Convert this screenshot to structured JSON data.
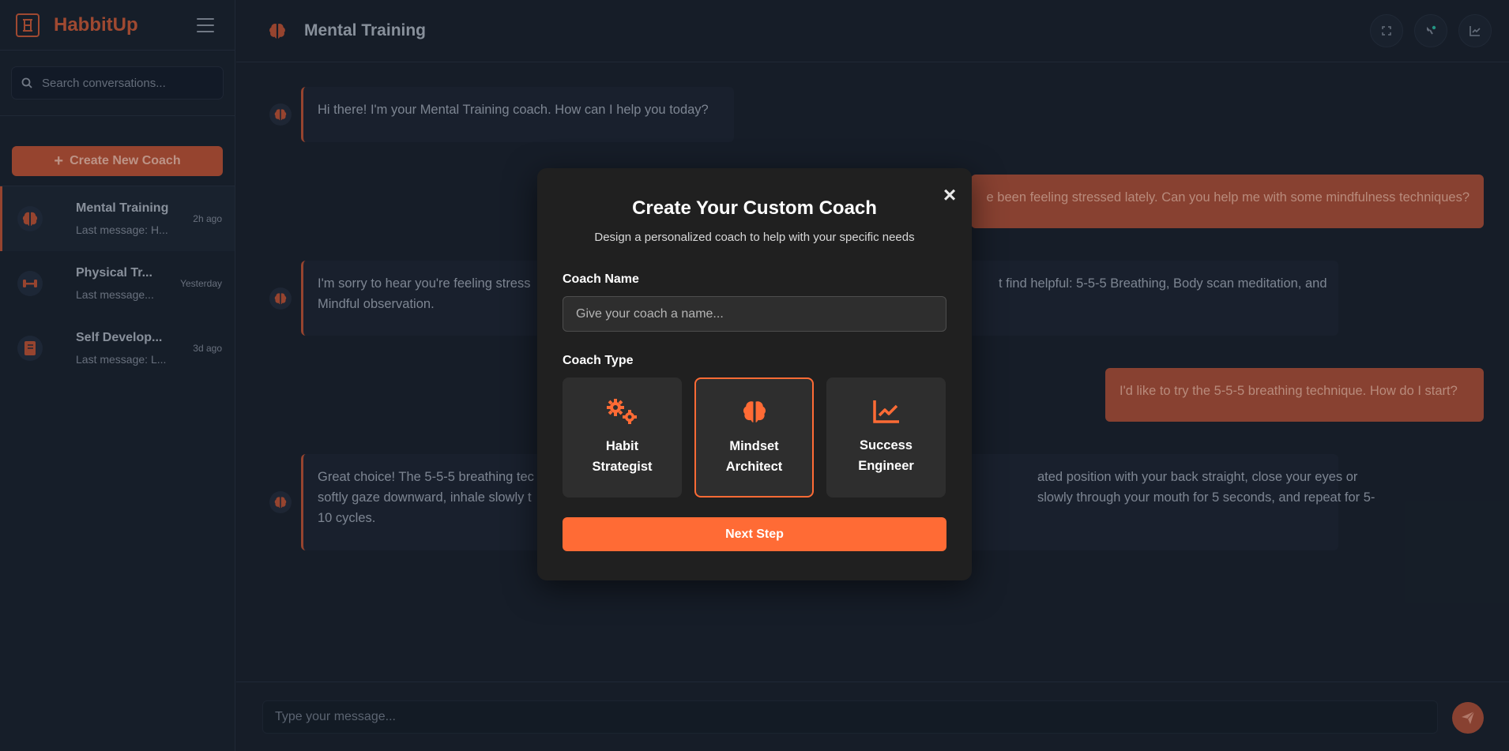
{
  "app": {
    "name": "HabbitUp",
    "accent": "#ff6b35"
  },
  "sidebar": {
    "search_placeholder": "Search conversations...",
    "create_label": "Create New Coach",
    "conversations": [
      {
        "title": "Mental Training",
        "last": "Last message: H...",
        "time": "2h ago",
        "icon": "brain-icon",
        "active": true
      },
      {
        "title": "Physical Tr...",
        "last": "Last message...",
        "time": "Yesterday",
        "icon": "dumbbell-icon",
        "active": false
      },
      {
        "title": "Self Develop...",
        "last": "Last message: L...",
        "time": "3d ago",
        "icon": "book-icon",
        "active": false
      }
    ]
  },
  "header": {
    "title": "Mental Training",
    "icon": "brain-icon",
    "actions": [
      "fullscreen-icon",
      "palette-icon",
      "chart-icon"
    ]
  },
  "messages": [
    {
      "role": "bot",
      "text": "Hi there! I'm your Mental Training coach. How can I help you today?"
    },
    {
      "role": "user",
      "text": "e been feeling stressed lately. Can you help me with some mindfulness techniques?"
    },
    {
      "role": "bot",
      "line1_left": "I'm sorry to hear you're feeling stress",
      "line1_right": "t find helpful: 5-5-5 Breathing, Body scan meditation, and",
      "line2": "Mindful observation."
    },
    {
      "role": "user",
      "text": "I'd like to try the 5-5-5 breathing technique. How do I start?"
    },
    {
      "role": "bot",
      "line1_left": "Great choice! The 5-5-5 breathing tec",
      "line1_right": "ated position with your back straight, close your eyes or",
      "line2_left": "softly gaze downward, inhale slowly t",
      "line2_right": "slowly through your mouth for 5 seconds, and repeat for 5-",
      "line3": "10 cycles."
    }
  ],
  "composer": {
    "placeholder": "Type your message..."
  },
  "modal": {
    "title": "Create Your Custom Coach",
    "subtitle": "Design a personalized coach to help with your specific needs",
    "name_label": "Coach Name",
    "name_placeholder": "Give your coach a name...",
    "type_label": "Coach Type",
    "types": [
      {
        "label": "Habit Strategist",
        "icon": "gears-icon",
        "selected": false
      },
      {
        "label": "Mindset Architect",
        "icon": "brain-icon",
        "selected": true
      },
      {
        "label": "Success Engineer",
        "icon": "line-chart-icon",
        "selected": false
      }
    ],
    "next_label": "Next Step"
  }
}
